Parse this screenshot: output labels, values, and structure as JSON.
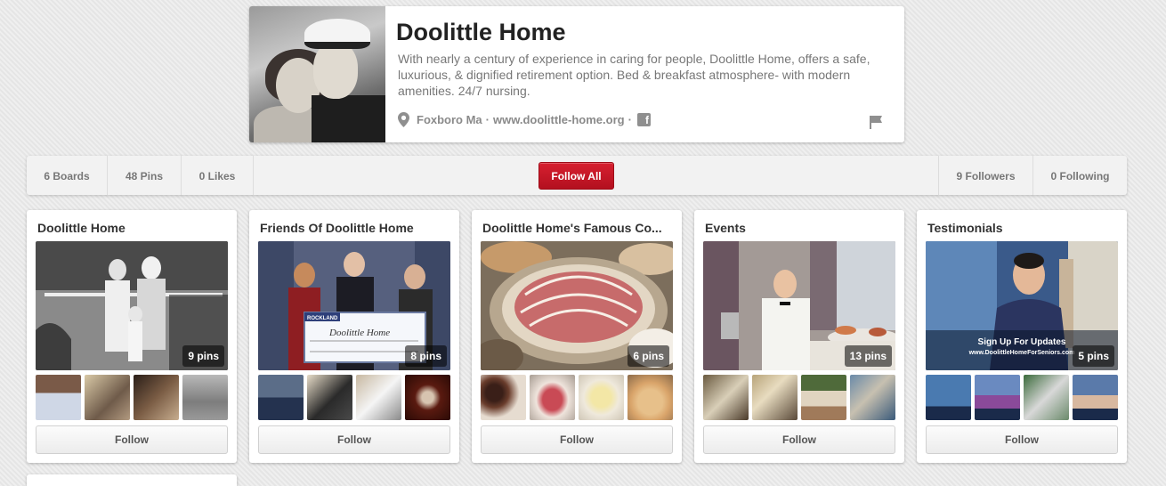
{
  "profile": {
    "name": "Doolittle Home",
    "description": "With nearly a century of experience in caring for people, Doolittle Home, offers a safe, luxurious, & dignified retirement option. Bed & breakfast atmosphere- with modern amenities. 24/7 nursing.",
    "location": "Foxboro Ma",
    "separator1": "·",
    "website": "www.doolittle-home.org",
    "separator2": "·",
    "facebook_glyph": "f"
  },
  "stats": {
    "boards": "6 Boards",
    "pins": "48 Pins",
    "likes": "0 Likes",
    "follow_all": "Follow All",
    "followers": "9 Followers",
    "following": "0 Following"
  },
  "boards": [
    {
      "title": "Doolittle Home",
      "pins": "9 pins",
      "follow": "Follow"
    },
    {
      "title": "Friends Of Doolittle Home",
      "pins": "8 pins",
      "follow": "Follow"
    },
    {
      "title": "Doolittle Home's Famous Co...",
      "pins": "6 pins",
      "follow": "Follow"
    },
    {
      "title": "Events",
      "pins": "13 pins",
      "follow": "Follow"
    },
    {
      "title": "Testimonials",
      "pins": "5 pins",
      "follow": "Follow"
    }
  ],
  "overlay_text": {
    "cheque_bank": "ROCKLAND",
    "cheque_payee": "Doolittle Home",
    "video_caption": "Sign Up For Updates",
    "video_url": "www.DoolittleHomeForSeniors.com"
  },
  "colors": {
    "accent_red": "#c5161f",
    "page_bg": "#e9e9e9"
  }
}
